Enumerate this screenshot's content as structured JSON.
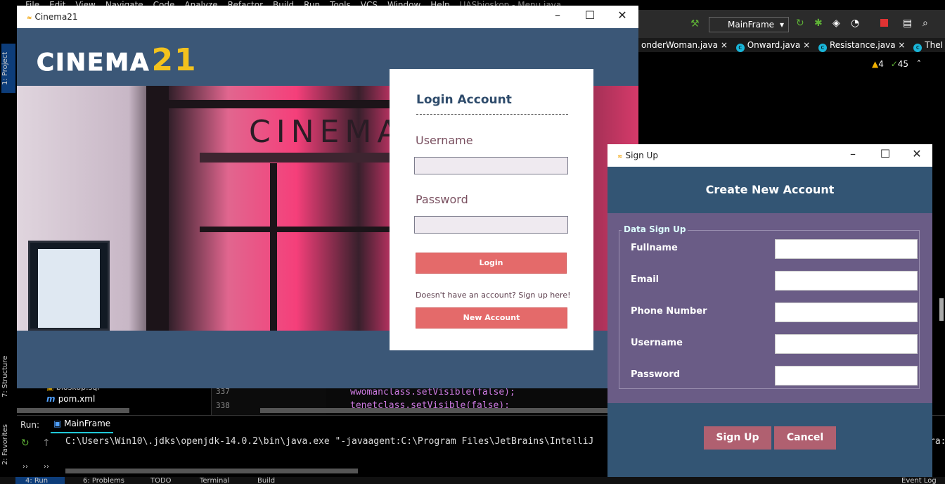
{
  "ide": {
    "menu": [
      "File",
      "Edit",
      "View",
      "Navigate",
      "Code",
      "Analyze",
      "Refactor",
      "Build",
      "Run",
      "Tools",
      "VCS",
      "Window",
      "Help",
      "UASbioskop - Menu.java"
    ],
    "run_config": "MainFrame",
    "editor_tabs": [
      "onderWoman.java",
      "Onward.java",
      "Resistance.java",
      "TheI"
    ],
    "warnings": "4",
    "checks": "45",
    "side_tabs": {
      "project": "1: Project",
      "structure": "7: Structure",
      "favorites": "2: Favorites"
    },
    "files": [
      "bioskop.sql",
      "pom.xml"
    ],
    "code_lines": [
      {
        "num": "337",
        "text": "wwomanclass.setVisible(false);"
      },
      {
        "num": "338",
        "text": "tenetclass.setVisible(false);"
      }
    ],
    "run_label": "Run:",
    "run_tab": "MainFrame",
    "console_line": "C:\\Users\\Win10\\.jdks\\openjdk-14.0.2\\bin\\java.exe \"-javaagent:C:\\Program Files\\JetBrains\\IntelliJ",
    "console_tail": "ra:",
    "status_tabs": [
      "4: Run",
      "6: Problems",
      "TODO",
      "Terminal",
      "Build"
    ],
    "event_log": "Event Log"
  },
  "cinema": {
    "title": "Cinema21",
    "logo_text": "CINEMA",
    "logo_number": "21",
    "banner_sign": "CINEMA",
    "login_title": "Login Account",
    "username_label": "Username",
    "username_value": "",
    "password_label": "Password",
    "password_value": "",
    "login_button": "Login",
    "signup_hint": "Doesn't have an account? Sign up here!",
    "new_account_button": "New Account"
  },
  "signup": {
    "title": "Sign Up",
    "header": "Create New Account",
    "group_title": "Data Sign Up",
    "fields": [
      {
        "label": "Fullname",
        "value": ""
      },
      {
        "label": "Email",
        "value": ""
      },
      {
        "label": "Phone Number",
        "value": ""
      },
      {
        "label": "Username",
        "value": ""
      },
      {
        "label": "Password",
        "value": ""
      }
    ],
    "signup_button": "Sign Up",
    "cancel_button": "Cancel"
  },
  "colors": {
    "accent_red": "#e46a6a",
    "panel_blue": "#3b5777",
    "form_purple": "#6a5c86",
    "logo_gold": "#f3c21d"
  }
}
